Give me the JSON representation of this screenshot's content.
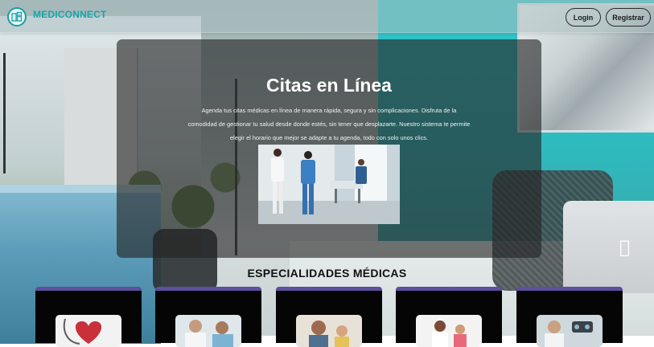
{
  "nav": {
    "brand": "MEDICONNECT",
    "login_label": "Login",
    "register_label": "Registrar"
  },
  "hero": {
    "title": "Citas en Línea",
    "description": "Agenda tus citas médicas en línea de manera rápida, segura y sin complicaciones. Disfruta de la comodidad de gestionar tu salud desde donde estés, sin tener que desplazarte. Nuestro sistema te permite elegir el horario que mejor se adapte a tu agenda, todo con solo unos clics."
  },
  "specialties": {
    "title": "ESPECIALIDADES MÉDICAS",
    "cards": [
      {
        "name": "cardiology"
      },
      {
        "name": "general"
      },
      {
        "name": "pediatrics"
      },
      {
        "name": "pediatrics-2"
      },
      {
        "name": "ophthalmology"
      }
    ]
  },
  "colors": {
    "brand": "#1aa5a8",
    "card_border": "#5d4f9c",
    "hero_overlay": "rgba(35,35,35,0.62)"
  }
}
